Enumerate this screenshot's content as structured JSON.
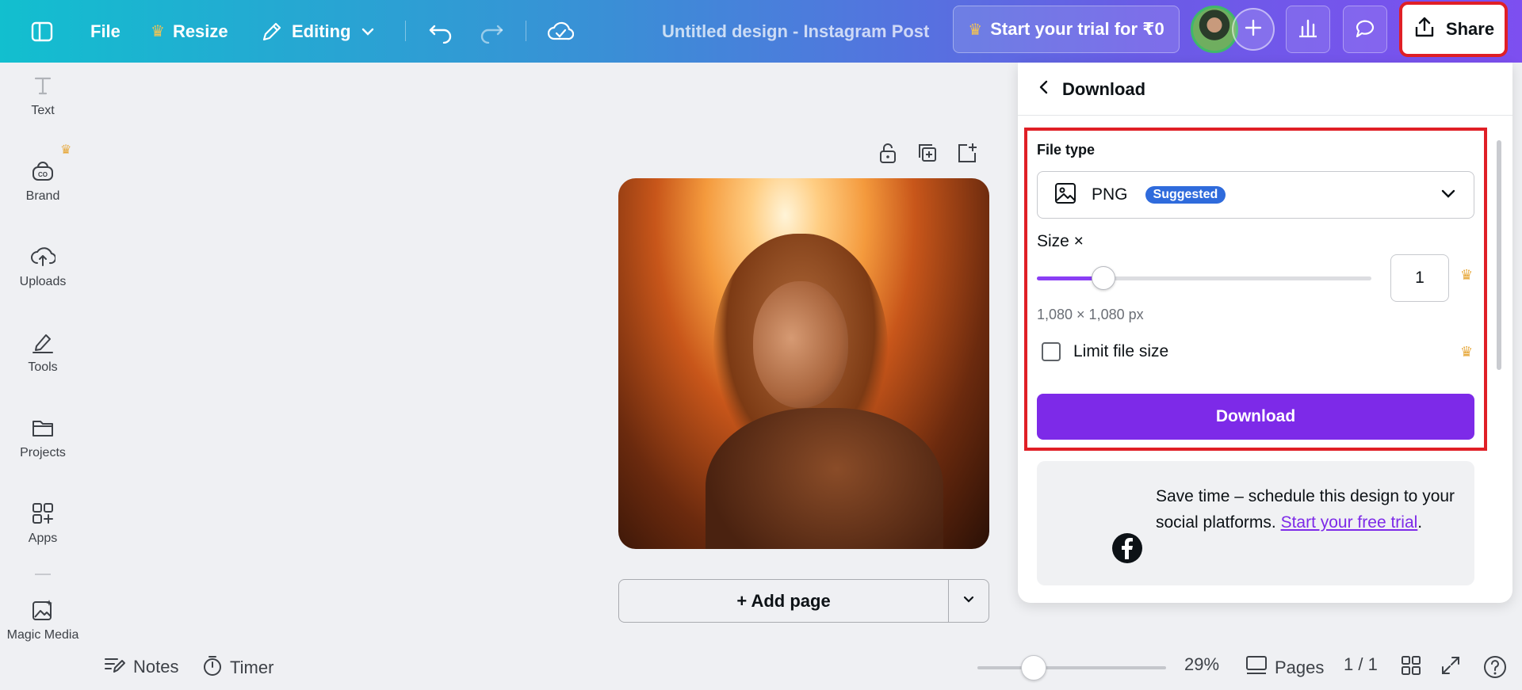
{
  "topbar": {
    "file_label": "File",
    "resize_label": "Resize",
    "editing_label": "Editing",
    "design_title": "Untitled design - Instagram Post",
    "trial_label": "Start your trial for ₹0",
    "share_label": "Share",
    "gradient_start": "#12bfcf",
    "gradient_end": "#7d4ff0"
  },
  "sidebar": {
    "items": [
      {
        "label": "Text",
        "icon": "text-icon"
      },
      {
        "label": "Brand",
        "icon": "brand-icon"
      },
      {
        "label": "Uploads",
        "icon": "cloud-upload-icon"
      },
      {
        "label": "Tools",
        "icon": "pen-tools-icon"
      },
      {
        "label": "Projects",
        "icon": "folder-icon"
      },
      {
        "label": "Apps",
        "icon": "apps-icon"
      },
      {
        "label": "Magic Media",
        "icon": "magic-media-icon"
      }
    ]
  },
  "canvas": {
    "add_page_label": "+ Add page"
  },
  "bottombar": {
    "notes_label": "Notes",
    "timer_label": "Timer",
    "zoom_percent": "29%",
    "zoom_value": 0.29,
    "pages_label": "Pages",
    "page_count": "1 / 1"
  },
  "download_panel": {
    "title": "Download",
    "file_type_label": "File type",
    "file_type_value": "PNG",
    "suggested_badge": "Suggested",
    "size_label": "Size ×",
    "size_value": "1",
    "size_slider_fraction": 0.2,
    "dimensions": "1,080 × 1,080 px",
    "limit_file_size_label": "Limit file size",
    "download_button": "Download",
    "promo_text": "Save time – schedule this design to your social platforms.",
    "promo_link": "Start your free trial",
    "promo_end": ".",
    "accent_color": "#7d2ae8",
    "highlight_color": "#e01f26"
  }
}
